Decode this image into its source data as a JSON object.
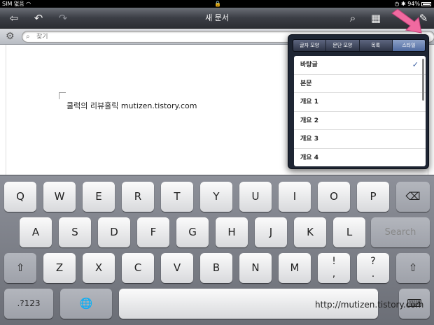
{
  "status": {
    "carrier": "SIM 없음",
    "wifi_icon": "wifi-icon",
    "lock_icon": "lock-icon",
    "battery": "94%"
  },
  "toolbar": {
    "title": "새 문서"
  },
  "search": {
    "placeholder": "찾기"
  },
  "document": {
    "text": "쿨럭의 리뷰홀릭 mutizen.tistory.com"
  },
  "popover": {
    "tabs": [
      "글자 모양",
      "문단 모양",
      "목록",
      "스타일"
    ],
    "active_tab": "스타일",
    "styles": [
      "바탕글",
      "본문",
      "개요 1",
      "개요 2",
      "개요 3",
      "개요 4"
    ],
    "selected": "바탕글",
    "check": "✓"
  },
  "keyboard": {
    "row1": [
      "Q",
      "W",
      "E",
      "R",
      "T",
      "Y",
      "U",
      "I",
      "O",
      "P"
    ],
    "row2": [
      "A",
      "S",
      "D",
      "F",
      "G",
      "H",
      "J",
      "K",
      "L"
    ],
    "search_label": "Search",
    "row3": [
      "Z",
      "X",
      "C",
      "V",
      "B",
      "N",
      "M"
    ],
    "punct1_top": "!",
    "punct1_bottom": ",",
    "punct2_top": "?",
    "punct2_bottom": ".",
    "numbers_label": ".?123"
  },
  "watermark": "http://mutizen.tistory.com",
  "colors": {
    "accent_arrow": "#f06aa0",
    "popover_bg": "#1e2533"
  }
}
